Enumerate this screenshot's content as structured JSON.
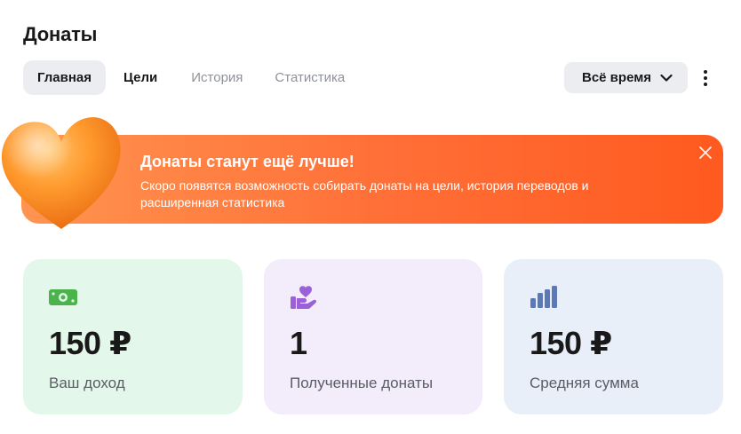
{
  "page": {
    "title": "Донаты"
  },
  "tabs": [
    {
      "label": "Главная"
    },
    {
      "label": "Цели"
    },
    {
      "label": "История"
    },
    {
      "label": "Статистика"
    }
  ],
  "period": {
    "label": "Всё время"
  },
  "banner": {
    "title": "Донаты станут ещё лучше!",
    "text": "Скоро появятся возможность собирать донаты на цели, история переводов и расширенная статистика"
  },
  "cards": [
    {
      "value": "150 ₽",
      "label": "Ваш доход",
      "icon": "cash-icon",
      "color": "#4bb34b"
    },
    {
      "value": "1",
      "label": "Полученные донаты",
      "icon": "heart-hand-icon",
      "color": "#9a62d6"
    },
    {
      "value": "150 ₽",
      "label": "Средняя сумма",
      "icon": "bar-chart-icon",
      "color": "#5c79b6"
    }
  ],
  "colors": {
    "banner_start": "#ff9450",
    "banner_end": "#ff5a1f",
    "text_primary": "#19191a",
    "text_secondary": "#8f9299"
  }
}
